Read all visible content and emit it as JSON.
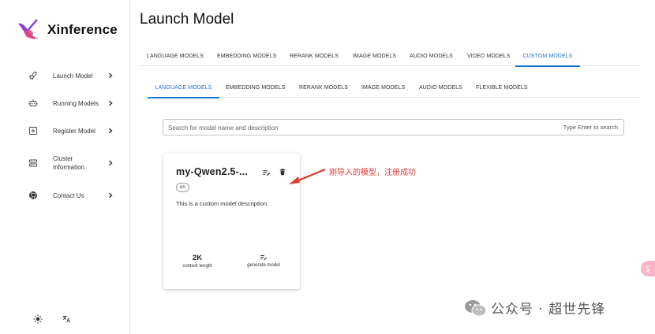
{
  "app": {
    "name": "Xinference"
  },
  "sidebar": {
    "items": [
      {
        "label": "Launch Model",
        "icon": "rocket-icon"
      },
      {
        "label": "Running Models",
        "icon": "robot-icon"
      },
      {
        "label": "Register Model",
        "icon": "add-box-icon"
      },
      {
        "label": "Cluster Information",
        "icon": "server-icon"
      },
      {
        "label": "Contact Us",
        "icon": "github-icon"
      }
    ],
    "footer": {
      "theme_icon": "sun-icon",
      "language_icon": "translate-icon"
    }
  },
  "page": {
    "title": "Launch Model"
  },
  "tabs": {
    "top": [
      "LANGUAGE MODELS",
      "EMBEDDING MODELS",
      "RERANK MODELS",
      "IMAGE MODELS",
      "AUDIO MODELS",
      "VIDEO MODELS",
      "CUSTOM MODELS"
    ],
    "top_active": "CUSTOM MODELS",
    "sub": [
      "LANGUAGE MODELS",
      "EMBEDDING MODELS",
      "RERANK MODELS",
      "IMAGE MODELS",
      "AUDIO MODELS",
      "FLEXIBLE MODELS"
    ],
    "sub_active": "LANGUAGE MODELS"
  },
  "search": {
    "placeholder": "Search for model name and description",
    "hint": "Type Enter to search"
  },
  "card": {
    "title": "my-Qwen2.5-...",
    "language": "en",
    "description": "This is a custom model description.",
    "context_length_value": "2K",
    "context_length_label": "context length",
    "generate_label": "generate model",
    "edit_icon": "edit-list-icon",
    "delete_icon": "trash-icon"
  },
  "annotation": {
    "text": "刚导入的模型，注册成功",
    "color": "#e03a2e"
  },
  "side_pill": {
    "text": "Ȿ"
  },
  "watermark": {
    "text": "公众号 · 超世先锋",
    "icon": "wechat-icon"
  },
  "colors": {
    "accent": "#1976d2",
    "annotation": "#e03a2e",
    "brand_purple": "#7b3fe4",
    "brand_pink": "#e8457a"
  }
}
